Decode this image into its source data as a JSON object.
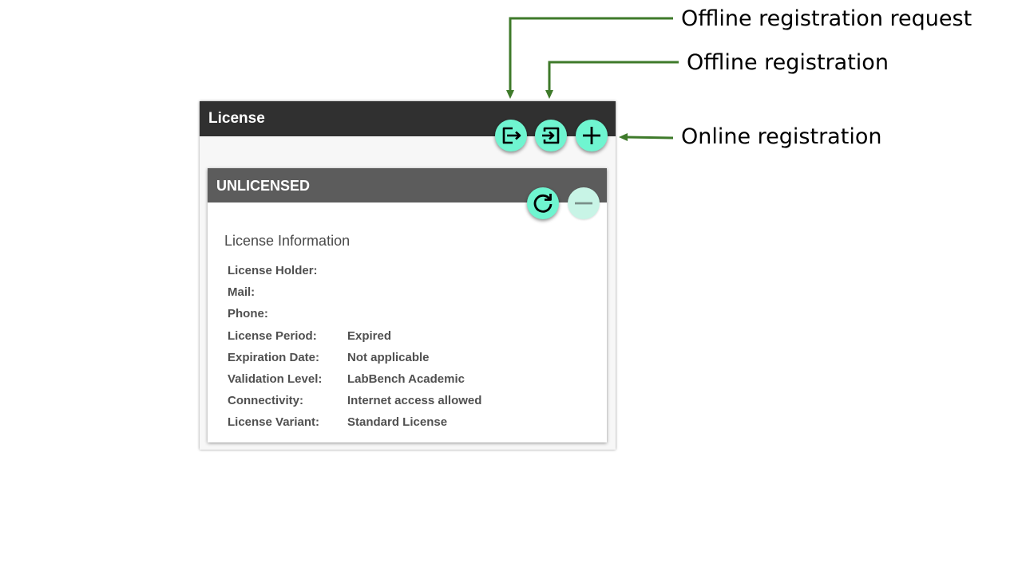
{
  "panel": {
    "title": "License",
    "buttons": {
      "offline_request_icon": "export-icon",
      "offline_registration_icon": "import-icon",
      "online_registration_icon": "plus-icon"
    }
  },
  "card": {
    "title": "UNLICENSED",
    "buttons": {
      "refresh_icon": "refresh-icon",
      "remove_icon": "minus-icon"
    },
    "section_title": "License Information",
    "fields": [
      {
        "label": "License Holder:",
        "value": ""
      },
      {
        "label": "Mail:",
        "value": ""
      },
      {
        "label": "Phone:",
        "value": ""
      },
      {
        "label": "License Period:",
        "value": "Expired"
      },
      {
        "label": "Expiration Date:",
        "value": "Not applicable"
      },
      {
        "label": "Validation Level:",
        "value": "LabBench Academic"
      },
      {
        "label": "Connectivity:",
        "value": "Internet access allowed"
      },
      {
        "label": "License Variant:",
        "value": "Standard License"
      }
    ]
  },
  "annotations": {
    "offline_request": "Offline registration request",
    "offline_registration": "Offline registration",
    "online_registration": "Online registration"
  },
  "colors": {
    "header_dark": "#303030",
    "card_header": "#5c5c5c",
    "fab_accent": "#6ff5d0",
    "arrow_green": "#3e7a2a"
  }
}
